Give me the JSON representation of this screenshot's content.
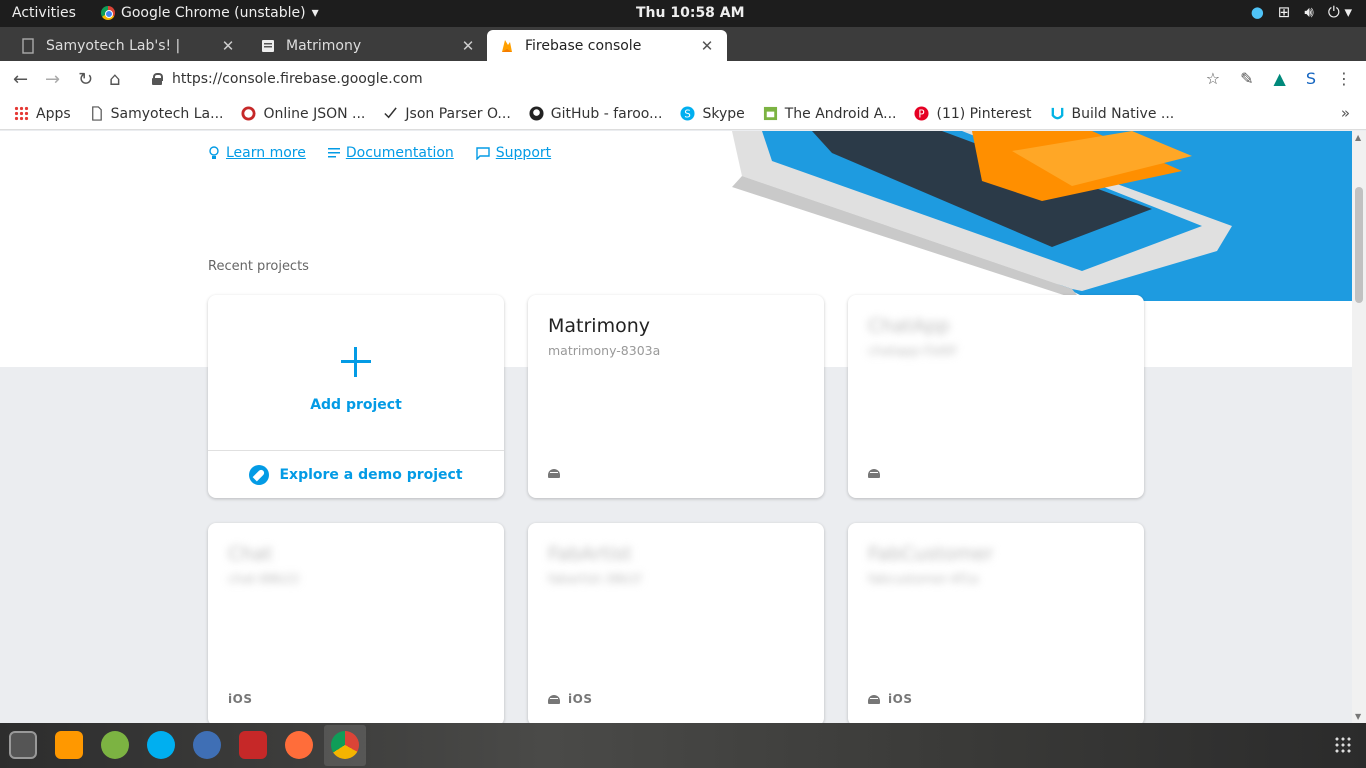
{
  "system": {
    "activities": "Activities",
    "app_name": "Google Chrome (unstable)",
    "clock": "Thu 10:58 AM"
  },
  "tabs": [
    {
      "title": "Samyotech Lab's! |",
      "active": false
    },
    {
      "title": "Matrimony",
      "active": false
    },
    {
      "title": "Firebase console",
      "active": true
    }
  ],
  "omnibox": {
    "url": "https://console.firebase.google.com"
  },
  "bookmarks": [
    {
      "label": "Apps",
      "icon": "apps-grid-icon"
    },
    {
      "label": "Samyotech La...",
      "icon": "page-icon"
    },
    {
      "label": "Online JSON ...",
      "icon": "json-icon"
    },
    {
      "label": "Json Parser O...",
      "icon": "json-parser-icon"
    },
    {
      "label": "GitHub - faroo...",
      "icon": "github-icon"
    },
    {
      "label": "Skype",
      "icon": "skype-icon"
    },
    {
      "label": "The Android A...",
      "icon": "android-icon"
    },
    {
      "label": "(11) Pinterest",
      "icon": "pinterest-icon"
    },
    {
      "label": "Build Native ...",
      "icon": "udacity-icon"
    }
  ],
  "links": {
    "learn_more": "Learn more",
    "documentation": "Documentation",
    "support": "Support"
  },
  "recent_label": "Recent projects",
  "add_card": {
    "add_label": "Add project",
    "explore_label": "Explore a demo project"
  },
  "projects": [
    {
      "name": "Matrimony",
      "id": "matrimony-8303a",
      "platforms": "android",
      "blurred": false
    },
    {
      "name": "ChatApp",
      "id": "chatapp-f3d0f",
      "platforms": "android",
      "blurred": true
    },
    {
      "name": "Chat",
      "id": "chat-88b22",
      "platforms": "ios",
      "blurred": true
    },
    {
      "name": "FabArtist",
      "id": "fabartist-38b1f",
      "platforms": "android+ios",
      "blurred": true
    },
    {
      "name": "FabCustomer",
      "id": "fabcustomer-4f1a",
      "platforms": "android+ios",
      "blurred": true
    }
  ],
  "platform_ios_label": "iOS",
  "colors": {
    "firebase_blue": "#039be5",
    "firebase_orange": "#ff8f00",
    "hero_blue": "#1e9be0"
  }
}
